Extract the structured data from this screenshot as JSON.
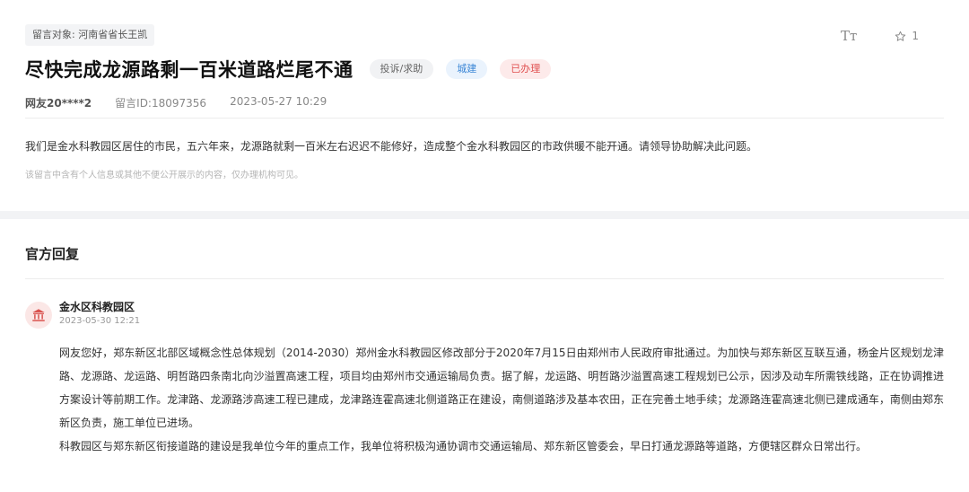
{
  "message": {
    "target_label": "留言对象:",
    "target_value": "河南省省长王凯",
    "title": "尽快完成龙源路剩一百米道路烂尾不通",
    "badges": [
      "投诉/求助",
      "城建",
      "已办理"
    ],
    "author": "网友20****2",
    "message_id": "留言ID:18097356",
    "datetime": "2023-05-27 10:29",
    "body": "我们是金水科教园区居住的市民，五六年来，龙源路就剩一百米左右迟迟不能修好，造成整个金水科教园区的市政供暖不能开通。请领导协助解决此问题。",
    "note": "该留言中含有个人信息或其他不便公开展示的内容，仅办理机构可见。"
  },
  "toolbar": {
    "font_size_glyph": "Tт",
    "star_count": "1"
  },
  "reply": {
    "section_title": "官方回复",
    "org_name": "金水区科教园区",
    "datetime": "2023-05-30 12:21",
    "paragraphs": [
      "网友您好，郑东新区北部区域概念性总体规划（2014-2030）郑州金水科教园区修改部分于2020年7月15日由郑州市人民政府审批通过。为加快与郑东新区互联互通，杨金片区规划龙津路、龙源路、龙运路、明哲路四条南北向沙溢置高速工程，项目均由郑州市交通运输局负责。据了解，龙运路、明哲路沙溢置高速工程规划已公示，因涉及动车所需铁线路，正在协调推进方案设计等前期工作。龙津路、龙源路涉高速工程已建成，龙津路连霍高速北侧道路正在建设，南侧道路涉及基本农田，正在完善土地手续；龙源路连霍高速北侧已建成通车，南侧由郑东新区负责，施工单位已进场。",
      "科教园区与郑东新区衔接道路的建设是我单位今年的重点工作，我单位将积极沟通协调市交通运输局、郑东新区管委会，早日打通龙源路等道路，方便辖区群众日常出行。"
    ]
  },
  "colors": {
    "badge_gray_bg": "#f1f2f4",
    "badge_blue_text": "#3a86d6",
    "badge_red_text": "#e05050",
    "org_icon": "#d9534f"
  },
  "icons": {
    "font": "font-size-icon",
    "star": "star-icon",
    "org": "government-building-icon"
  }
}
